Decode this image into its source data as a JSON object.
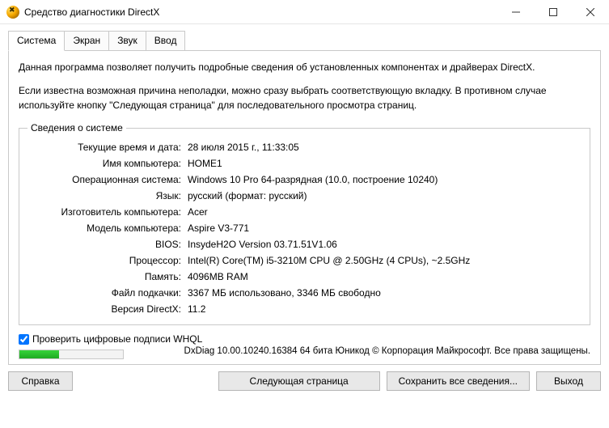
{
  "window": {
    "title": "Средство диагностики DirectX"
  },
  "tabs": {
    "system": "Система",
    "screen": "Экран",
    "sound": "Звук",
    "input": "Ввод"
  },
  "intro": {
    "p1": "Данная программа позволяет получить подробные сведения об установленных компонентах и драйверах DirectX.",
    "p2": "Если известна возможная причина неполадки, можно сразу выбрать соответствующую вкладку. В противном случае используйте кнопку \"Следующая страница\" для последовательного просмотра страниц."
  },
  "group": {
    "legend": "Сведения о системе"
  },
  "fields": {
    "datetime": {
      "label": "Текущие время и дата:",
      "value": "28 июля 2015 г., 11:33:05"
    },
    "hostname": {
      "label": "Имя компьютера:",
      "value": "HOME1"
    },
    "os": {
      "label": "Операционная система:",
      "value": "Windows 10 Pro 64-разрядная (10.0, построение 10240)"
    },
    "lang": {
      "label": "Язык:",
      "value": "русский (формат: русский)"
    },
    "manuf": {
      "label": "Изготовитель компьютера:",
      "value": "Acer"
    },
    "model": {
      "label": "Модель компьютера:",
      "value": "Aspire V3-771"
    },
    "bios": {
      "label": "BIOS:",
      "value": "InsydeH2O Version 03.71.51V1.06"
    },
    "cpu": {
      "label": "Процессор:",
      "value": "Intel(R) Core(TM) i5-3210M CPU @ 2.50GHz (4 CPUs), ~2.5GHz"
    },
    "ram": {
      "label": "Память:",
      "value": "4096MB RAM"
    },
    "pagefile": {
      "label": "Файл подкачки:",
      "value": "3367 МБ использовано, 3346 МБ свободно"
    },
    "dxver": {
      "label": "Версия DirectX:",
      "value": "11.2"
    }
  },
  "whql": {
    "label": "Проверить цифровые подписи WHQL",
    "checked": true
  },
  "copyright": "DxDiag 10.00.10240.16384 64 бита Юникод © Корпорация Майкрософт. Все права защищены.",
  "buttons": {
    "help": "Справка",
    "next": "Следующая страница",
    "save": "Сохранить все сведения...",
    "exit": "Выход"
  }
}
